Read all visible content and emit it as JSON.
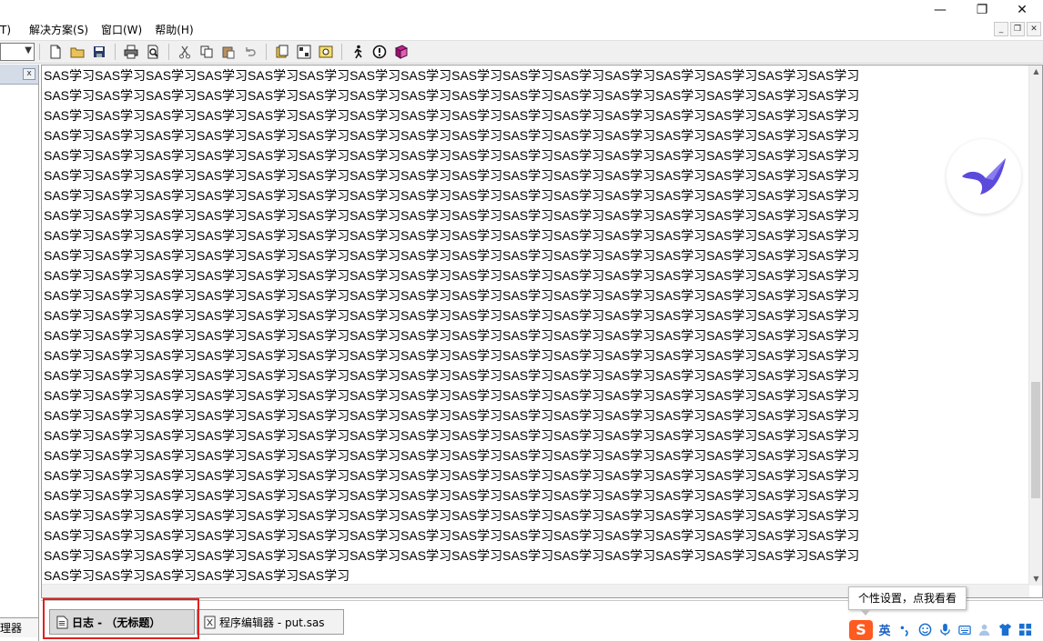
{
  "window": {
    "minimize_glyph": "—",
    "restore_glyph": "❐",
    "close_glyph": "✕"
  },
  "menu": {
    "partial_label": "T)",
    "items": [
      "解决方案(S)",
      "窗口(W)",
      "帮助(H)"
    ]
  },
  "mdi": {
    "minimize": "_",
    "restore": "❐",
    "close": "✕"
  },
  "toolbar": {
    "icons": [
      "new-document-icon",
      "open-folder-icon",
      "save-icon",
      "print-icon",
      "print-preview-icon",
      "cut-icon",
      "copy-icon",
      "paste-icon",
      "undo-icon",
      "libraries-icon",
      "explorer-icon",
      "find-icon",
      "submit-run-icon",
      "break-icon",
      "help-book-icon"
    ]
  },
  "left_panel": {
    "close_label": "x",
    "tab_label": "理器"
  },
  "log": {
    "text_unit": "SAS学习",
    "full_lines": 25,
    "repeats_per_line": 16,
    "last_line": "SAS学习SAS学习SAS学习SAS学习SAS学习SAS学习"
  },
  "window_tabs": [
    {
      "label": "日志 - （无标题）",
      "active": true
    },
    {
      "label": "程序编辑器 - put.sas",
      "active": false
    }
  ],
  "ime": {
    "logo": "S",
    "language": "英",
    "tooltip": "个性设置，点我看看",
    "icons": [
      "punctuation-icon",
      "emoji-icon",
      "microphone-icon",
      "keyboard-icon",
      "user-icon",
      "skin-icon",
      "toolbox-icon"
    ]
  },
  "colors": {
    "highlight": "#e02020",
    "ime_brand": "#ff5a1f",
    "badge_bird": "#5b4bdb"
  }
}
